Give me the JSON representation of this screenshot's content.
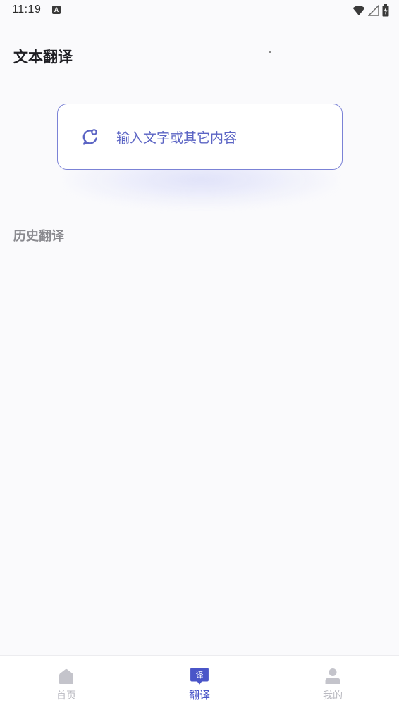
{
  "status_bar": {
    "time": "11:19",
    "notification_icon": "A"
  },
  "page": {
    "title": "文本翻译"
  },
  "input_card": {
    "placeholder": "输入文字或其它内容",
    "icon": "chat-bubble-icon",
    "accent_color": "#5b64c4",
    "border_color": "#7b82d6"
  },
  "history": {
    "label": "历史翻译",
    "items": []
  },
  "bottom_nav": {
    "items": [
      {
        "label": "首页",
        "icon": "home-icon",
        "active": false
      },
      {
        "label": "翻译",
        "icon": "translate-icon",
        "active": true
      },
      {
        "label": "我的",
        "icon": "user-icon",
        "active": false
      }
    ],
    "active_color": "#4a55c8",
    "inactive_color": "#b9b9c0"
  }
}
